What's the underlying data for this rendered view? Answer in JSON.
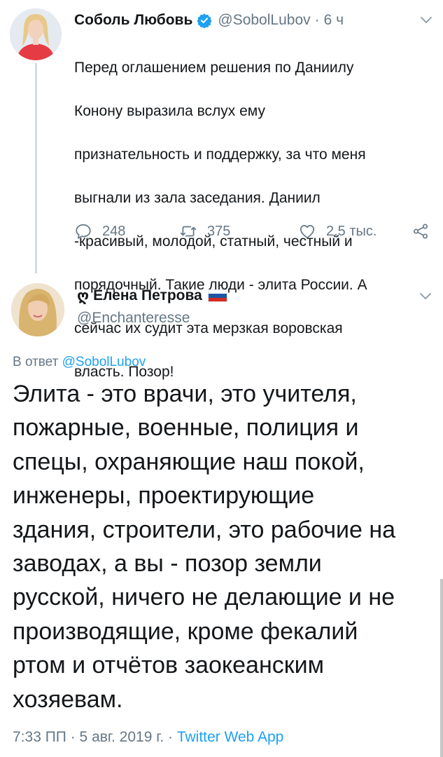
{
  "tweet1": {
    "name": "Соболь Любовь",
    "handle": "@SobolLubov",
    "time": "6 ч",
    "separator": "·",
    "lines": [
      "Перед оглашением решения по Даниилу",
      "Конону выразила вслух ему",
      "признательность и поддержку, за что меня",
      "выгнали из зала заседания. Даниил",
      "-красивый, молодой, статный, честный и",
      "порядочный. Такие люди - элита России. А",
      "сейчас их судит эта мерзкая воровская",
      "власть. Позор!"
    ],
    "replies": "248",
    "retweets": "375",
    "likes": "2,5 тыс."
  },
  "tweet2": {
    "swirl": "ღ",
    "name": "Елена Петрова",
    "handle": "@Enchanteresse",
    "reply_prefix": "В ответ",
    "reply_handle": "@SobolLubov",
    "lines": [
      "Элита - это врачи, это учителя,",
      "пожарные, военные, полиция и",
      "спецы, охраняющие наш покой,",
      "инженеры, проектирующие",
      "здания, строители, это рабочие на",
      "заводах, а вы - позор земли",
      "русской, ничего не делающие и не",
      "производящие, кроме фекалий",
      "ртом и отчётов заокеанским",
      "хозяевам."
    ],
    "datetime": "7:33 ПП · 5 авг. 2019 г.",
    "meta_separator": "·",
    "source": "Twitter Web App"
  },
  "icons": {
    "verified": "verified-badge-icon",
    "caret": "chevron-down-icon",
    "reply": "reply-icon",
    "retweet": "retweet-icon",
    "like": "heart-icon",
    "share": "share-icon",
    "flag": "russia-flag-icon"
  },
  "colors": {
    "link": "#1da1f2",
    "secondary_text": "#657786",
    "primary_text": "#14171a",
    "thread_line": "#d4dbe1"
  }
}
